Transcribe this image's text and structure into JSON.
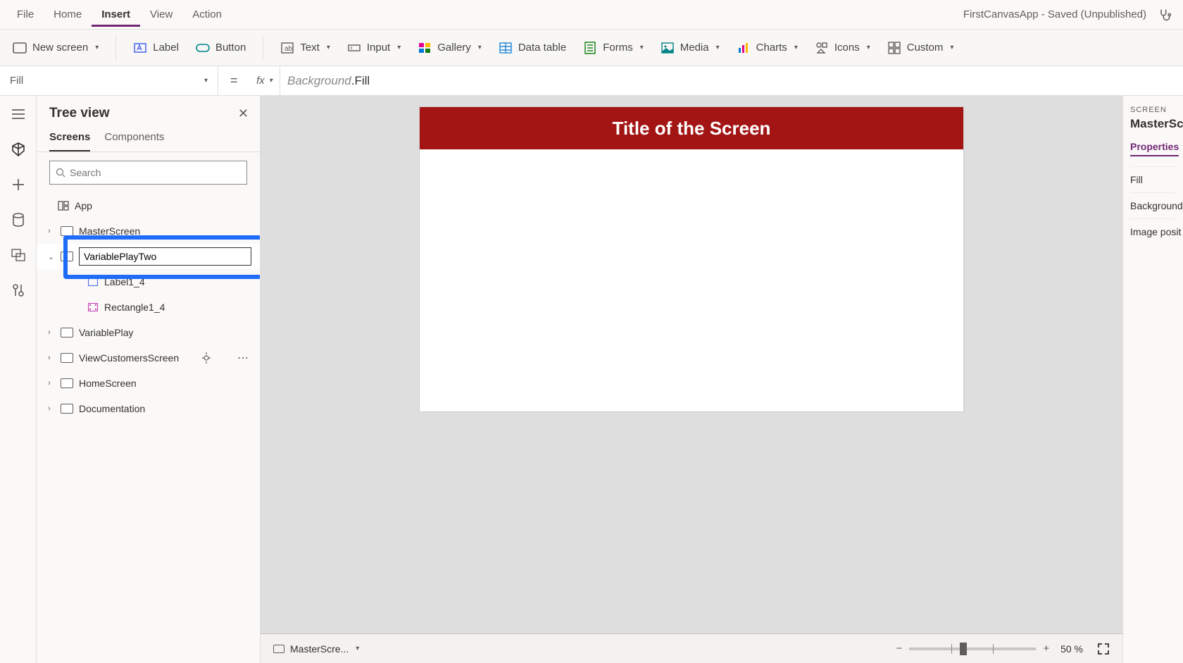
{
  "app_title": "FirstCanvasApp - Saved (Unpublished)",
  "menubar": {
    "items": [
      "File",
      "Home",
      "Insert",
      "View",
      "Action"
    ],
    "active": "Insert"
  },
  "ribbon": {
    "new_screen": "New screen",
    "label": "Label",
    "button": "Button",
    "text": "Text",
    "input": "Input",
    "gallery": "Gallery",
    "data_table": "Data table",
    "forms": "Forms",
    "media": "Media",
    "charts": "Charts",
    "icons": "Icons",
    "custom": "Custom"
  },
  "formula": {
    "property": "Fill",
    "object": "Background",
    "prop": ".Fill"
  },
  "tree": {
    "title": "Tree view",
    "tabs": [
      "Screens",
      "Components"
    ],
    "active_tab": "Screens",
    "search_placeholder": "Search",
    "app_label": "App",
    "items": {
      "master": "MasterScreen",
      "rename_value": "VariablePlayTwo",
      "label1_4": "Label1_4",
      "rect1_4": "Rectangle1_4",
      "variableplay": "VariablePlay",
      "viewcust": "ViewCustomersScreen",
      "home": "HomeScreen",
      "doc": "Documentation"
    }
  },
  "canvas": {
    "title_text": "Title of the Screen",
    "footer_screen": "MasterScre...",
    "zoom": "50",
    "pct": "%"
  },
  "props": {
    "caption": "SCREEN",
    "object": "MasterScre",
    "tab": "Properties",
    "rows": [
      "Fill",
      "Background",
      "Image posit"
    ]
  }
}
